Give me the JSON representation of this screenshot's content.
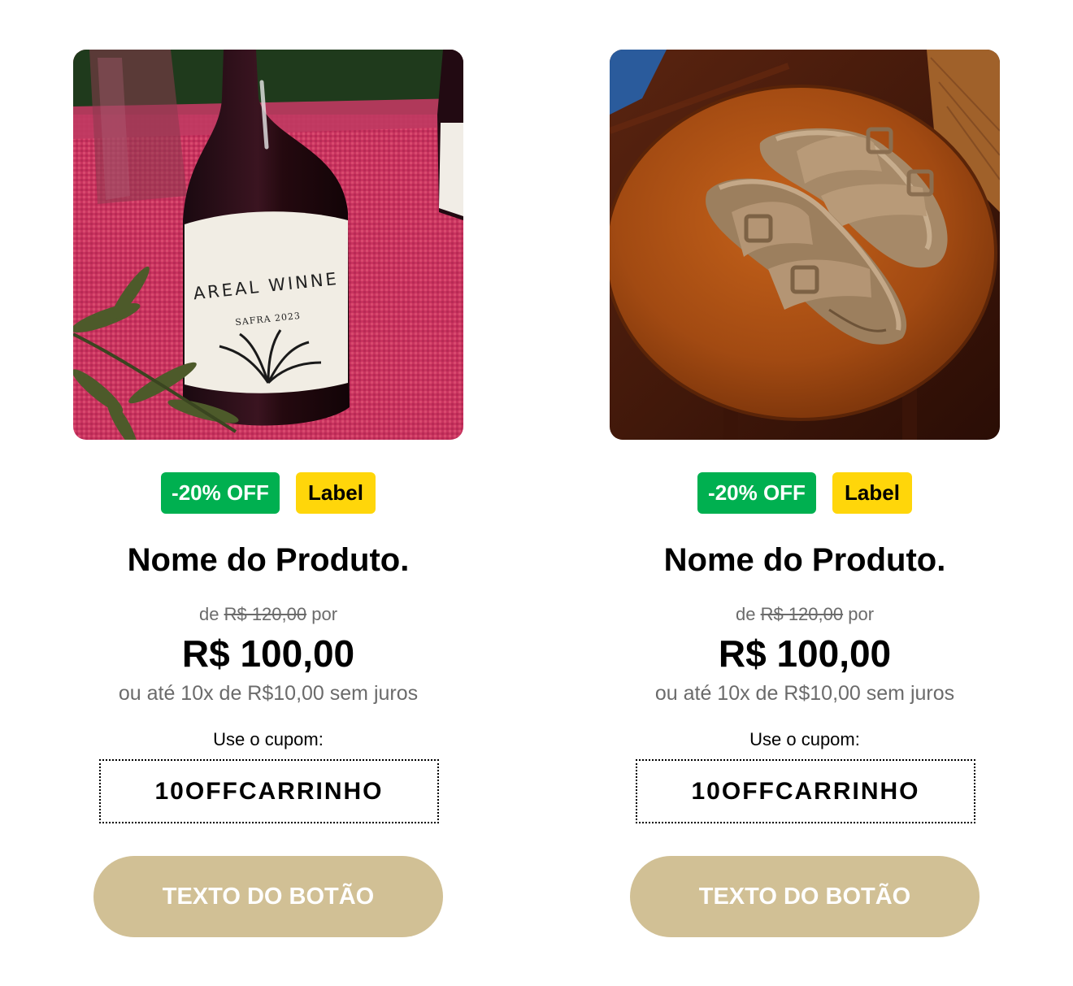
{
  "products": [
    {
      "image_alt": "wine-bottle-photo",
      "image_label_brand": "AREAL WINNE",
      "image_label_vintage": "SAFRA 2023",
      "discount_badge": "-20% OFF",
      "label_badge": "Label",
      "name": "Nome do Produto.",
      "old_price_prefix": "de",
      "old_price": "R$ 120,00",
      "old_price_suffix": "por",
      "price": "R$ 100,00",
      "installments": "ou até 10x de R$10,00 sem juros",
      "coupon_label": "Use o cupom:",
      "coupon_code": "10OFFCARRINHO",
      "button_label": "TEXTO DO BOTÃO"
    },
    {
      "image_alt": "sandals-photo",
      "discount_badge": "-20% OFF",
      "label_badge": "Label",
      "name": "Nome do Produto.",
      "old_price_prefix": "de",
      "old_price": "R$ 120,00",
      "old_price_suffix": "por",
      "price": "R$ 100,00",
      "installments": "ou até 10x de R$10,00 sem juros",
      "coupon_label": "Use o cupom:",
      "coupon_code": "10OFFCARRINHO",
      "button_label": "TEXTO DO BOTÃO"
    }
  ],
  "colors": {
    "discount_badge_bg": "#00b050",
    "label_badge_bg": "#ffd60a",
    "button_bg": "#d1c095",
    "muted_text": "#6b6b6b"
  }
}
